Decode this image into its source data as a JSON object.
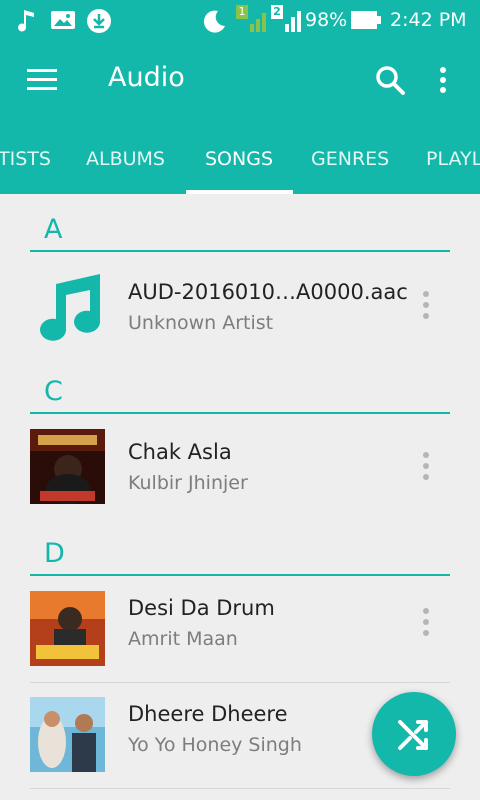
{
  "status_bar": {
    "battery": "98%",
    "time": "2:42 PM",
    "sim1": "1",
    "sim2": "2",
    "icons": [
      "music-note-icon",
      "image-icon",
      "download-icon",
      "moon-icon",
      "signal-icon",
      "battery-icon"
    ]
  },
  "toolbar": {
    "title": "Audio",
    "icons": [
      "menu-icon",
      "search-icon",
      "more-vert-icon"
    ]
  },
  "tabs": [
    {
      "label": "ARTISTS",
      "display": "TISTS"
    },
    {
      "label": "ALBUMS"
    },
    {
      "label": "SONGS",
      "active": true
    },
    {
      "label": "GENRES"
    },
    {
      "label": "PLAYLISTS",
      "display": "PLAYL"
    }
  ],
  "sections": [
    {
      "letter": "A",
      "songs": [
        {
          "title": "AUD-2016010…A0000.aac",
          "artist": "Unknown Artist"
        }
      ]
    },
    {
      "letter": "C",
      "songs": [
        {
          "title": "Chak Asla",
          "artist": "Kulbir Jhinjer"
        }
      ]
    },
    {
      "letter": "D",
      "songs": [
        {
          "title": "Desi Da Drum",
          "artist": "Amrit Maan"
        },
        {
          "title": "Dheere Dheere",
          "artist": "Yo Yo Honey Singh"
        }
      ]
    }
  ],
  "fab": {
    "icon": "shuffle-icon"
  },
  "colors": {
    "accent": "#13b8aa",
    "background": "#eeeeee",
    "title_text": "#222222",
    "artist_text": "#7d7d7d"
  }
}
